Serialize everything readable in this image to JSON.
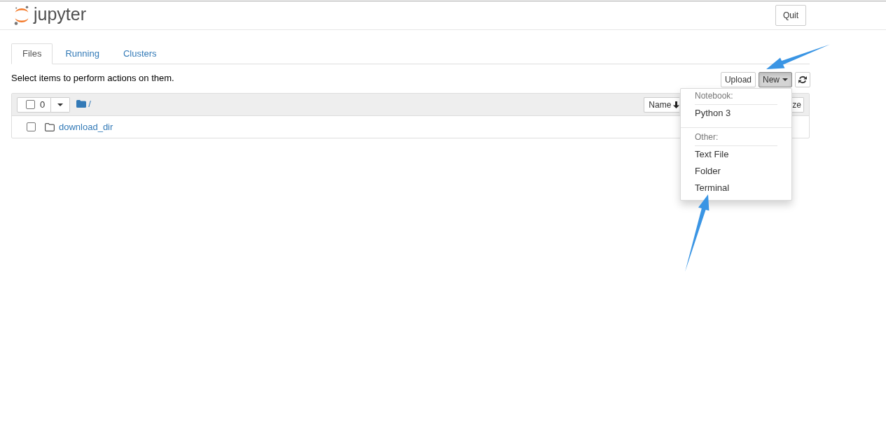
{
  "header": {
    "logo": "jupyter",
    "quit_button": "Quit"
  },
  "tabs": [
    {
      "label": "Files",
      "selected": true
    },
    {
      "label": "Running",
      "selected": false
    },
    {
      "label": "Clusters",
      "selected": false
    }
  ],
  "toolbar": {
    "hint": "Select items to perform actions on them.",
    "buttons": [
      {
        "kind": "text",
        "label": "Upload",
        "active": false
      },
      {
        "kind": "dropdown",
        "label": "New",
        "active": true
      },
      {
        "kind": "icon",
        "active": false
      }
    ]
  },
  "file_list": {
    "select_all": {
      "checked": false,
      "count": "0"
    },
    "path": "/",
    "sort_buttons": [
      {
        "kind": "sorted",
        "label": "Name"
      },
      {
        "kind": "plain",
        "label": "ze"
      }
    ],
    "rows": [
      {
        "kind": "folder",
        "name": "download_dir",
        "checked": false
      }
    ]
  },
  "new_menu": {
    "open": true,
    "sections": [
      {
        "header": "Notebook:",
        "items": [
          {
            "label": "Python 3"
          }
        ]
      },
      {
        "header": "Other:",
        "items": [
          {
            "label": "Text File"
          },
          {
            "label": "Folder"
          },
          {
            "label": "Terminal"
          }
        ]
      }
    ]
  }
}
